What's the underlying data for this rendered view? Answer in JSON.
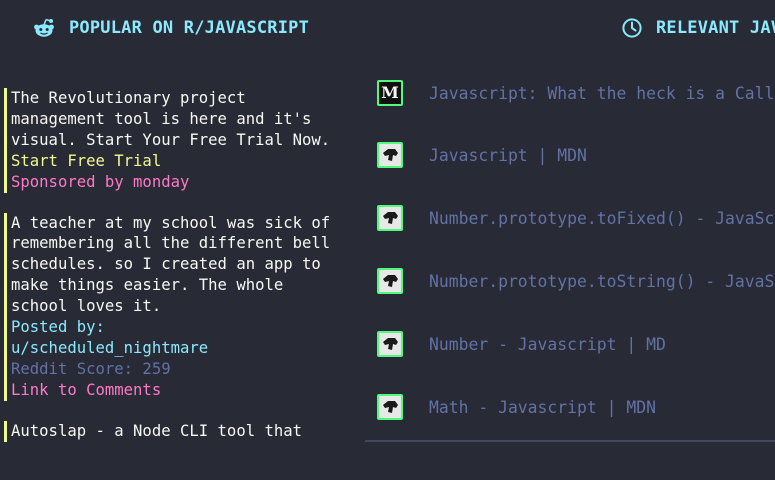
{
  "headers": {
    "popular": "POPULAR ON R/JAVASCRIPT",
    "relevant": "RELEVANT JAVASCRIPT RESOURCES"
  },
  "sponsored": {
    "text": "The Revolutionary project management tool is here and it's visual. Start Your Free Trial Now.",
    "cta": "Start Free Trial",
    "sponsor": "Sponsored by monday"
  },
  "posts": [
    {
      "title": "A teacher at my school was sick of remembering all the different bell schedules. so I created an app to make things easier. The whole school loves it.",
      "posted_by_label": "Posted by:",
      "author": "u/scheduled_nightmare",
      "score": "Reddit Score: 259",
      "comments": "Link to Comments"
    },
    {
      "title": "Autoslap - a Node CLI tool that"
    }
  ],
  "resources": [
    {
      "title": "Javascript: What the heck is a Callback?",
      "icon": "medium-icon"
    },
    {
      "title": "Javascript | MDN",
      "icon": "mdn-icon"
    },
    {
      "title": "Number.prototype.toFixed() - JavaScript | MDN",
      "icon": "mdn-icon"
    },
    {
      "title": "Number.prototype.toString() - JavaScript | MDN",
      "icon": "mdn-icon"
    },
    {
      "title": "Number - Javascript | MD",
      "icon": "mdn-icon"
    },
    {
      "title": "Math - Javascript | MDN",
      "icon": "mdn-icon"
    }
  ],
  "colors": {
    "background": "#282a36",
    "header": "#8be9fd",
    "text": "#f8f8f2",
    "yellow": "#f1fa8c",
    "pink": "#ff79c6",
    "cyan": "#8be9fd",
    "comment": "#6272a4",
    "green": "#50fa7b"
  }
}
